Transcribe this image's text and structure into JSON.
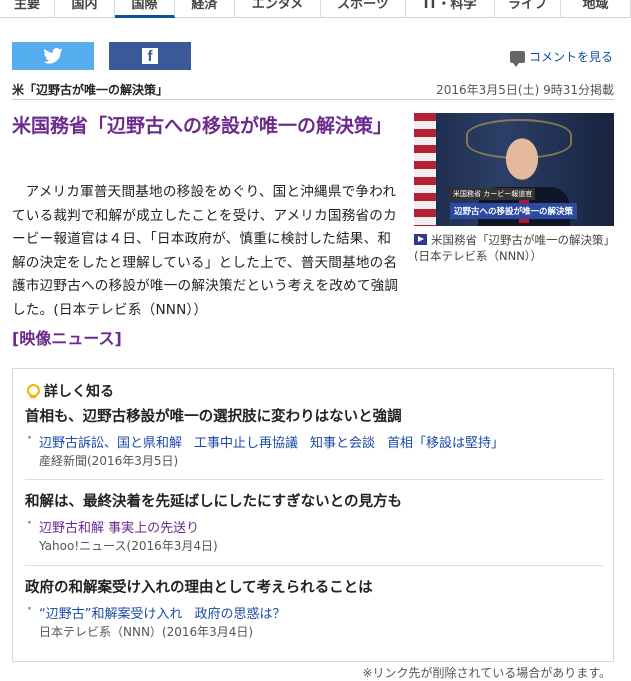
{
  "nav": {
    "tabs": [
      {
        "label": "主要",
        "width": 55
      },
      {
        "label": "国内",
        "width": 60
      },
      {
        "label": "国際",
        "width": 60,
        "active": true
      },
      {
        "label": "経済",
        "width": 60
      },
      {
        "label": "エンタメ",
        "width": 86
      },
      {
        "label": "スポーツ",
        "width": 85
      },
      {
        "label": "IT・科学",
        "width": 89
      },
      {
        "label": "ライフ",
        "width": 66
      },
      {
        "label": "地域",
        "width": 70
      }
    ]
  },
  "share": {
    "twitter_icon": "twitter-bird-icon",
    "facebook_icon": "facebook-f-icon",
    "facebook_glyph": "f"
  },
  "comment_link": "コメントを見る",
  "crumb": "米「辺野古が唯一の解決策」",
  "date": "2016年3月5日(土) 9時31分掲載",
  "article": {
    "headline": "米国務省「辺野古への移設が唯一の解決策」",
    "body": "アメリカ軍普天間基地の移設をめぐり、国と沖縄県で争われている裁判で和解が成立したことを受け、アメリカ国務省のカービー報道官は４日、「日本政府が、慎重に検討した結果、和解の決定をしたと理解している」とした上で、普天間基地の名護市辺野古への移設が唯一の解決策だという考えを改めて強調した。(日本テレビ系（NNN））",
    "video_label": "[映像ニュース]"
  },
  "photo": {
    "tag": "米国務省 カービー報道官",
    "caption_overlay": "辺野古への移設が唯一の解決策",
    "caption": "米国務省「辺野古が唯一の解決策」(日本テレビ系（NNN））"
  },
  "more": {
    "title": "詳しく知る",
    "groups": [
      {
        "title": "首相も、辺野古移設が唯一の選択肢に変わりはないと強調",
        "links": [
          "辺野古訴訟、国と県和解",
          "工事中止し再協議",
          "知事と会談",
          "首相「移設は堅持」"
        ],
        "source": "産経新聞(2016年3月5日)"
      },
      {
        "title": "和解は、最終決着を先延ばしにしたにすぎないとの見方も",
        "links": [
          "辺野古和解 事実上の先送り"
        ],
        "source": "Yahoo!ニュース(2016年3月4日)"
      },
      {
        "title": "政府の和解案受け入れの理由として考えられることは",
        "links": [
          "“辺野古”和解案受け入れ",
          "政府の思惑は？"
        ],
        "source": "日本テレビ系（NNN）(2016年3月4日)"
      }
    ]
  },
  "footer_note": "※リンク先が削除されている場合があります。"
}
